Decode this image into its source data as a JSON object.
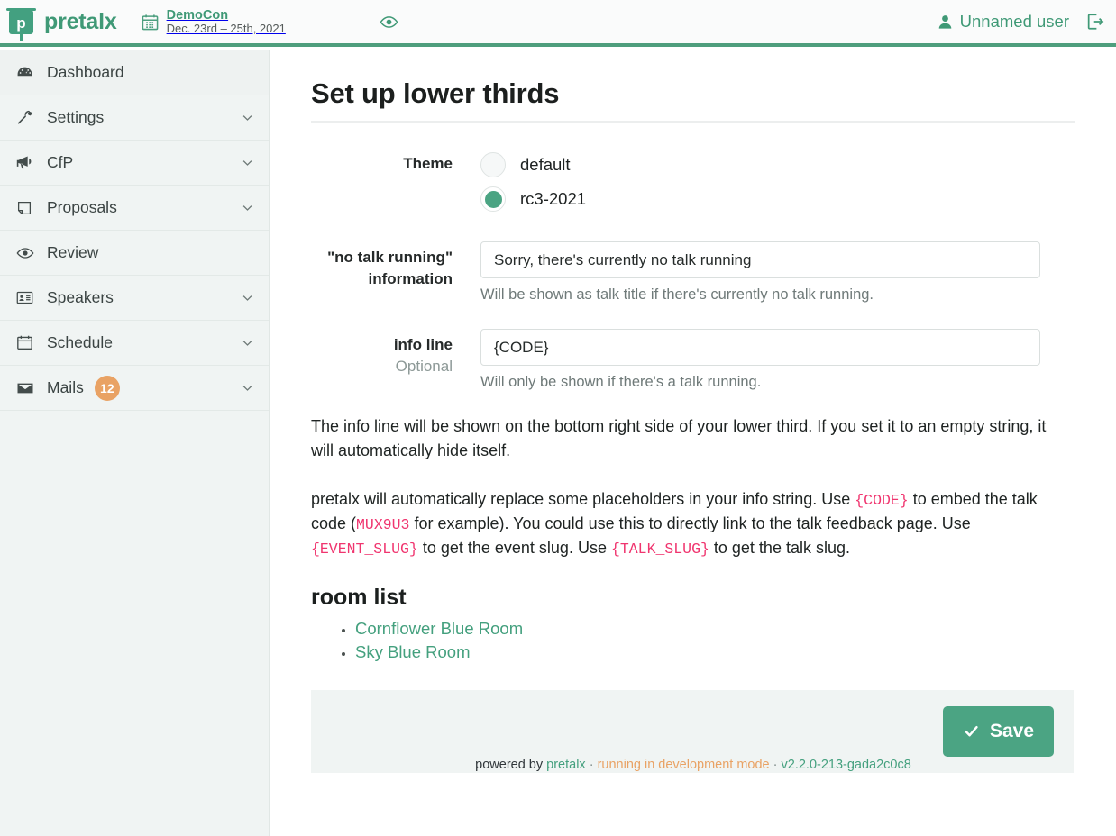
{
  "header": {
    "brand": "pretalx",
    "brand_logo_letter": "p",
    "event_name": "DemoCon",
    "event_dates": "Dec. 23rd – 25th, 2021",
    "preview_icon": "eye-icon",
    "user_name": "Unnamed user",
    "user_icon": "user-icon",
    "logout_icon": "logout-icon",
    "accent_color": "#3f9976",
    "rule_color": "#4e9e7d"
  },
  "sidebar": {
    "items": [
      {
        "label": "Dashboard",
        "icon": "dashboard-icon",
        "caret": false,
        "active": true,
        "badge": null
      },
      {
        "label": "Settings",
        "icon": "wrench-icon",
        "caret": true,
        "active": false,
        "badge": null
      },
      {
        "label": "CfP",
        "icon": "megaphone-icon",
        "caret": true,
        "active": false,
        "badge": null
      },
      {
        "label": "Proposals",
        "icon": "document-icon",
        "caret": true,
        "active": false,
        "badge": null
      },
      {
        "label": "Review",
        "icon": "eye-icon",
        "caret": false,
        "active": false,
        "badge": null
      },
      {
        "label": "Speakers",
        "icon": "id-card-icon",
        "caret": true,
        "active": false,
        "badge": null
      },
      {
        "label": "Schedule",
        "icon": "calendar-icon",
        "caret": true,
        "active": false,
        "badge": null
      },
      {
        "label": "Mails",
        "icon": "envelope-icon",
        "caret": true,
        "active": false,
        "badge": "12"
      }
    ],
    "badge_color": "#e9a264",
    "background_color": "#f0f4f3"
  },
  "main": {
    "title": "Set up lower thirds",
    "theme_field": {
      "label": "Theme",
      "options": [
        {
          "value": "default",
          "label": "default",
          "selected": false
        },
        {
          "value": "rc3-2021",
          "label": "rc3-2021",
          "selected": true
        }
      ]
    },
    "no_talk_field": {
      "label": "\"no talk running\" information",
      "value": "Sorry, there's currently no talk running",
      "help": "Will be shown as talk title if there's currently no talk running."
    },
    "info_line_field": {
      "label": "info line",
      "optional": "Optional",
      "value": "{CODE}",
      "help": "Will only be shown if there's a talk running."
    },
    "paragraph_1": "The info line will be shown on the bottom right side of your lower third. If you set it to an empty string, it will automatically hide itself.",
    "paragraph_2": {
      "part_1": "pretalx will automatically replace some placeholders in your info string. Use ",
      "code_1": "{CODE}",
      "part_2": " to embed the talk code (",
      "code_2": "MUX9U3",
      "part_3": " for example). You could use this to directly link to the talk feedback page. Use ",
      "code_3": "{EVENT_SLUG}",
      "part_4": " to get the event slug. Use ",
      "code_4": "{TALK_SLUG}",
      "part_5": " to get the talk slug."
    },
    "room_list": {
      "title": "room list",
      "rooms": [
        "Cornflower Blue Room",
        "Sky Blue Room"
      ]
    },
    "save_label": "Save",
    "save_icon": "check-icon",
    "save_color": "#4ba483",
    "placeholder_color": "#f0356f"
  },
  "footer": {
    "powered_by": "powered by ",
    "pretalx": "pretalx",
    "sep1": " · ",
    "dev_mode": "running in development mode",
    "sep2": " · ",
    "version": "v2.2.0-213-gada2c0c8"
  }
}
